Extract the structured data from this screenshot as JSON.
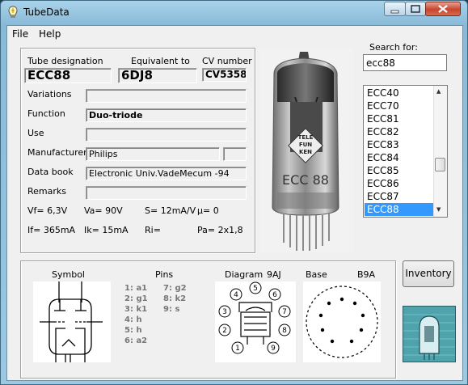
{
  "window": {
    "title": "TubeData"
  },
  "menu": {
    "file": "File",
    "help": "Help"
  },
  "headers": {
    "designation": "Tube designation",
    "equivalent": "Equivalent to",
    "cv": "CV number"
  },
  "values": {
    "designation": "ECC88",
    "equivalent": "6DJ8",
    "cv": "CV5358"
  },
  "fields": [
    {
      "label": "Variations",
      "value": ""
    },
    {
      "label": "Function",
      "value": "Duo-triode"
    },
    {
      "label": "Use",
      "value": ""
    },
    {
      "label": "Manufacturer",
      "value": "Philips"
    },
    {
      "label": "Data book",
      "value": "Electronic Univ.VadeMecum -94"
    },
    {
      "label": "Remarks",
      "value": ""
    }
  ],
  "specs": {
    "vf": "Vf= 6,3V",
    "va": "Va=  90V",
    "s": "S= 12mA/V",
    "mu": "µ=    0",
    "if": "If= 365mA",
    "ik": "Ik=   15mA",
    "ri": "Ri=",
    "pa": "Pa= 2x1,8"
  },
  "search": {
    "label": "Search for:",
    "value": "ecc88"
  },
  "list": {
    "items": [
      "ECC40",
      "ECC70",
      "ECC81",
      "ECC82",
      "ECC83",
      "ECC84",
      "ECC85",
      "ECC86",
      "ECC87",
      "ECC88"
    ],
    "selected": "ECC88"
  },
  "bottom": {
    "symbol": "Symbol",
    "pins": "Pins",
    "diagram": "Diagram",
    "diagram_code": "9AJ",
    "base": "Base",
    "base_code": "B9A",
    "pins_left": [
      "1: a1",
      "2: g1",
      "3: k1",
      "4: h",
      "5: h",
      "6: a2"
    ],
    "pins_right": [
      "7: g2",
      "8: k2",
      "9: s"
    ]
  },
  "buttons": {
    "inventory": "Inventory"
  },
  "tube_glass_labels": {
    "brand": [
      "TELE",
      "FUN",
      "KEN"
    ],
    "type": "ECC 88"
  },
  "colors": {
    "selection": "#3399ff",
    "titlebar": "#99c6e2",
    "close": "#c7452c"
  }
}
